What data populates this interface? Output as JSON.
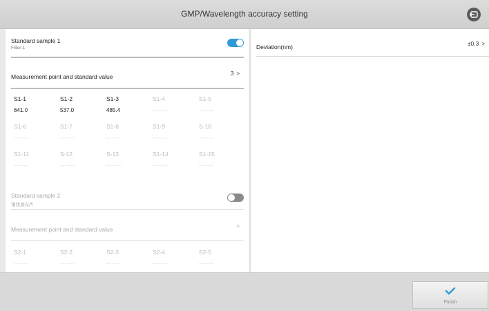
{
  "header": {
    "title": "GMP/Wavelength accuracy setting",
    "back_icon": "exit-icon"
  },
  "sample1": {
    "title": "Standard sample 1",
    "subtitle": "Filter-1",
    "toggle_on": true,
    "measure_label": "Measurement point and standard value",
    "measure_value": "3",
    "chevron": ">",
    "points": [
      {
        "label": "S1-1",
        "value": "641.0"
      },
      {
        "label": "S1-2",
        "value": "537.0"
      },
      {
        "label": "S1-3",
        "value": "485.4"
      },
      {
        "label": "S1-4",
        "value": "------"
      },
      {
        "label": "S1-5",
        "value": "------"
      },
      {
        "label": "S1-6",
        "value": "------"
      },
      {
        "label": "S1-7",
        "value": "------"
      },
      {
        "label": "S1-8",
        "value": "------"
      },
      {
        "label": "S1-9",
        "value": "------"
      },
      {
        "label": "S-10",
        "value": "------"
      },
      {
        "label": "S1-11",
        "value": "------"
      },
      {
        "label": "S-12",
        "value": "------"
      },
      {
        "label": "S-13",
        "value": "------"
      },
      {
        "label": "S1-14",
        "value": "------"
      },
      {
        "label": "S1-15",
        "value": "------"
      }
    ]
  },
  "sample2": {
    "title": "Standard sample 2",
    "subtitle": "镨钕滤光片",
    "toggle_on": false,
    "measure_label": "Measurement point and standard value",
    "chevron": ">",
    "points": [
      {
        "label": "S2-1",
        "value": "------"
      },
      {
        "label": "S2-2",
        "value": "------"
      },
      {
        "label": "S2-3",
        "value": "------"
      },
      {
        "label": "S2-4",
        "value": "------"
      },
      {
        "label": "S2-5",
        "value": "------"
      }
    ]
  },
  "deviation": {
    "label": "Deviation(nm)",
    "value": "±0.3",
    "chevron": ">"
  },
  "footer": {
    "finish_label": "Finish",
    "finish_icon": "checkmark-icon"
  },
  "colors": {
    "accent": "#2f9bd6",
    "toggle_off": "#8a8a8a"
  }
}
